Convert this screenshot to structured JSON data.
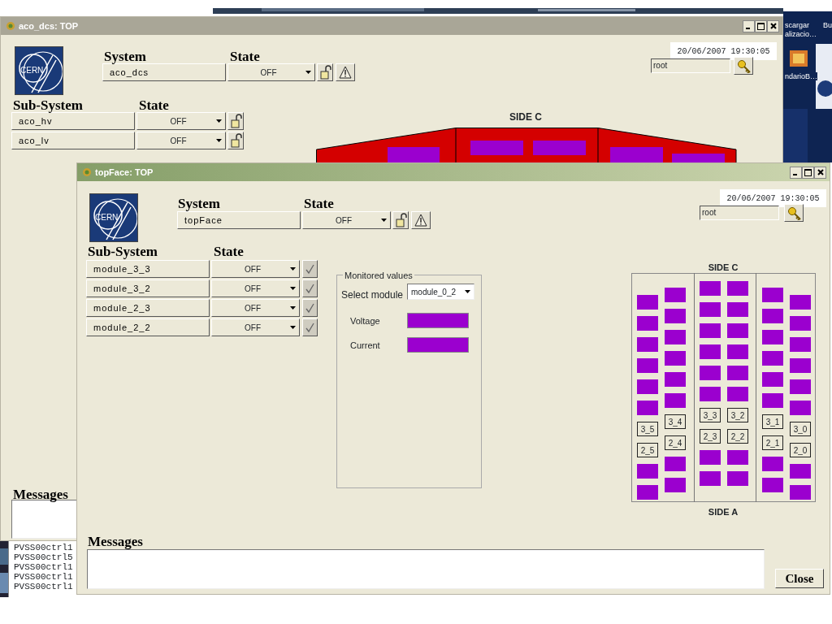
{
  "desktop": {
    "icon_labels": [
      "scargar",
      "alizacio…",
      "ndarioB…",
      "Bu"
    ]
  },
  "log_window": {
    "lines": [
      "PVSS00ctrl1",
      "PVSS00ctrl5",
      "PVSS00ctrl1",
      "PVSS00ctrl1",
      "PVSS00ctrl1"
    ]
  },
  "windows": [
    {
      "title": "aco_dcs: TOP",
      "active": false,
      "logo_text": "CERN",
      "system_heading": "System",
      "state_heading": "State",
      "system": {
        "name": "aco_dcs",
        "state": "OFF"
      },
      "subsystem_heading": "Sub-System",
      "substate_heading": "State",
      "rows": [
        {
          "name": "aco_hv",
          "state": "OFF",
          "kind": "lock"
        },
        {
          "name": "aco_lv",
          "state": "OFF",
          "kind": "lock"
        }
      ],
      "datetime": "20/06/2007 19:30:05",
      "user": "root",
      "side_label": "SIDE C",
      "messages_heading": "Messages"
    },
    {
      "title": "topFace: TOP",
      "active": true,
      "logo_text": "CERN",
      "system_heading": "System",
      "state_heading": "State",
      "system": {
        "name": "topFace",
        "state": "OFF"
      },
      "subsystem_heading": "Sub-System",
      "substate_heading": "State",
      "rows": [
        {
          "name": "module_3_3",
          "state": "OFF",
          "kind": "check"
        },
        {
          "name": "module_3_2",
          "state": "OFF",
          "kind": "check"
        },
        {
          "name": "module_2_3",
          "state": "OFF",
          "kind": "check"
        },
        {
          "name": "module_2_2",
          "state": "OFF",
          "kind": "check"
        }
      ],
      "datetime": "20/06/2007 19:30:05",
      "user": "root",
      "messages_heading": "Messages",
      "monitor": {
        "title": "Monitored values",
        "select_label": "Select module",
        "select_value": "module_0_2",
        "fields": [
          {
            "label": "Voltage"
          },
          {
            "label": "Current"
          }
        ]
      },
      "map": {
        "top_label": "SIDE C",
        "bottom_label": "SIDE A",
        "columns": [
          {
            "cells": [
              {
                "kind": "module"
              },
              {
                "kind": "module"
              },
              {
                "kind": "module"
              },
              {
                "kind": "module"
              },
              {
                "kind": "module"
              },
              {
                "kind": "module"
              },
              {
                "kind": "label",
                "text": "3_5"
              },
              {
                "kind": "label",
                "text": "2_5"
              },
              {
                "kind": "module"
              },
              {
                "kind": "module"
              }
            ]
          },
          {
            "cells": [
              {
                "kind": "module"
              },
              {
                "kind": "module"
              },
              {
                "kind": "module"
              },
              {
                "kind": "module"
              },
              {
                "kind": "module"
              },
              {
                "kind": "module"
              },
              {
                "kind": "label",
                "text": "3_4"
              },
              {
                "kind": "label",
                "text": "2_4"
              },
              {
                "kind": "module"
              },
              {
                "kind": "module"
              }
            ]
          },
          {
            "cells": [
              {
                "kind": "module"
              },
              {
                "kind": "module"
              },
              {
                "kind": "module"
              },
              {
                "kind": "module"
              },
              {
                "kind": "module"
              },
              {
                "kind": "module"
              },
              {
                "kind": "label",
                "text": "3_3"
              },
              {
                "kind": "label",
                "text": "2_3"
              },
              {
                "kind": "module"
              },
              {
                "kind": "module"
              }
            ]
          },
          {
            "cells": [
              {
                "kind": "module"
              },
              {
                "kind": "module"
              },
              {
                "kind": "module"
              },
              {
                "kind": "module"
              },
              {
                "kind": "module"
              },
              {
                "kind": "module"
              },
              {
                "kind": "label",
                "text": "3_2"
              },
              {
                "kind": "label",
                "text": "2_2"
              },
              {
                "kind": "module"
              },
              {
                "kind": "module"
              }
            ]
          },
          {
            "cells": [
              {
                "kind": "module"
              },
              {
                "kind": "module"
              },
              {
                "kind": "module"
              },
              {
                "kind": "module"
              },
              {
                "kind": "module"
              },
              {
                "kind": "module"
              },
              {
                "kind": "label",
                "text": "3_1"
              },
              {
                "kind": "label",
                "text": "2_1"
              },
              {
                "kind": "module"
              },
              {
                "kind": "module"
              }
            ]
          },
          {
            "cells": [
              {
                "kind": "module"
              },
              {
                "kind": "module"
              },
              {
                "kind": "module"
              },
              {
                "kind": "module"
              },
              {
                "kind": "module"
              },
              {
                "kind": "module"
              },
              {
                "kind": "label",
                "text": "3_0"
              },
              {
                "kind": "label",
                "text": "2_0"
              },
              {
                "kind": "module"
              },
              {
                "kind": "module"
              }
            ]
          }
        ]
      },
      "close_button": "Close"
    }
  ]
}
